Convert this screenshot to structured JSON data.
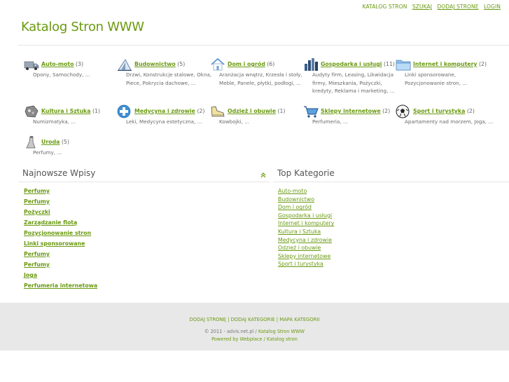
{
  "topnav": {
    "katalog": "KATALOG STRON",
    "szukaj": "SZUKAJ",
    "dodaj": "DODAJ STRONE",
    "login": "LOGIN"
  },
  "site": {
    "title": "Katalog Stron WWW"
  },
  "categories": [
    {
      "name": "Auto-moto",
      "count": "(3)",
      "subs": "Opony, Samochody, ...",
      "icon": "truck-icon"
    },
    {
      "name": "Budownictwo",
      "count": "(5)",
      "subs": "Drzwi, Konstrukcje stalowe, Okna, Piece, Pokrycia dachowe, ...",
      "icon": "blueprint-icon"
    },
    {
      "name": "Dom i ogród",
      "count": "(6)",
      "subs": "Aranżacja wnętrz, Krzesła i stoły, Meble, Panele, płytki, podłogi, ...",
      "icon": "house-icon"
    },
    {
      "name": "Gospodarka i usługi",
      "count": "(11)",
      "subs": "Audyty firm, Leasing, Likwidacja firmy, Mieszkania, Pożyczki, kredyty, Reklama i marketing, ...",
      "icon": "bar-chart-icon"
    },
    {
      "name": "Internet i komputery",
      "count": "(2)",
      "subs": "Linki sponsorowane, Pozycjonowanie stron, ...",
      "icon": "folder-icon"
    },
    {
      "name": "Kultura i Sztuka",
      "count": "(1)",
      "subs": "Numizmatyka, ...",
      "icon": "palette-icon"
    },
    {
      "name": "Medycyna i zdrowie",
      "count": "(2)",
      "subs": "Leki, Medycyna estetyczna, ...",
      "icon": "medical-cross-icon"
    },
    {
      "name": "Odzież i obuwie",
      "count": "(1)",
      "subs": "Kowbojki, ...",
      "icon": "shoe-icon"
    },
    {
      "name": "Sklepy internetowe",
      "count": "(2)",
      "subs": "Perfumeria, ...",
      "icon": "shopping-cart-icon"
    },
    {
      "name": "Sport i turystyka",
      "count": "(2)",
      "subs": "Apartamenty nad morzem, Joga, ...",
      "icon": "ball-icon"
    },
    {
      "name": "Uroda",
      "count": "(5)",
      "subs": "Perfumy, ...",
      "icon": "perfume-icon"
    }
  ],
  "latest": {
    "title": "Najnowsze Wpisy",
    "items": [
      "Perfumy",
      "Perfumy",
      "Pożyczki",
      "Zarządzanie flotą",
      "Pozycjonowanie stron",
      "Linki sponsorowane",
      "Perfumy",
      "Perfumy",
      "Joga",
      "Perfumeria internetowa"
    ]
  },
  "top": {
    "title": "Top Kategorie",
    "items": [
      "Auto-moto",
      "Budownictwo",
      "Dom i ogród",
      "Gospodarka i usługi",
      "Internet i komputery",
      "Kultura i Sztuka",
      "Medycyna i zdrowie",
      "Odzież i obuwie",
      "Sklepy internetowe",
      "Sport i turystyka"
    ]
  },
  "footer": {
    "link1": "DODAJ STRONĘ",
    "link2": "DODAJ KATEGORIE",
    "link3": "MAPA KATEGORII",
    "sep": "|",
    "copy_prefix": "© 2011 - advis.net.pl /",
    "copy_link": "Katalog Stron WWW",
    "powered": "Powered by Webplace / Katalog stron"
  },
  "colors": {
    "accent": "#6a9a10",
    "footer_bg": "#e8e8e8"
  }
}
